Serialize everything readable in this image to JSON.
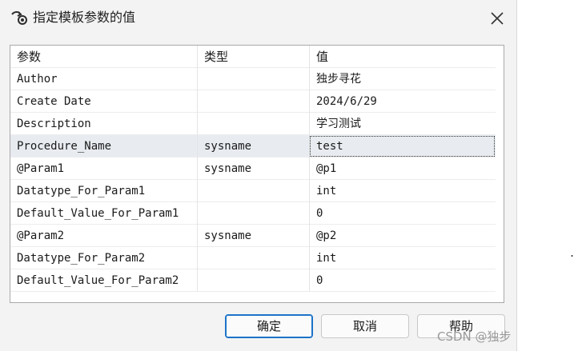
{
  "window": {
    "title": "指定模板参数的值"
  },
  "table": {
    "headers": [
      "参数",
      "类型",
      "值"
    ],
    "rows": [
      {
        "name": "Author",
        "type": "",
        "value": "独步寻花"
      },
      {
        "name": "Create Date",
        "type": "",
        "value": "2024/6/29"
      },
      {
        "name": "Description",
        "type": "",
        "value": "学习测试"
      },
      {
        "name": "Procedure_Name",
        "type": "sysname",
        "value": "test"
      },
      {
        "name": "@Param1",
        "type": "sysname",
        "value": "@p1"
      },
      {
        "name": "Datatype_For_Param1",
        "type": "",
        "value": "int"
      },
      {
        "name": "Default_Value_For_Param1",
        "type": "",
        "value": "0"
      },
      {
        "name": "@Param2",
        "type": "sysname",
        "value": "@p2"
      },
      {
        "name": "Datatype_For_Param2",
        "type": "",
        "value": "int"
      },
      {
        "name": "Default_Value_For_Param2",
        "type": "",
        "value": "0"
      }
    ],
    "selected_row": 3
  },
  "buttons": {
    "ok": "确定",
    "cancel": "取消",
    "help": "帮助"
  },
  "watermark": "CSDN @独步",
  "stray_mark": ".",
  "colors": {
    "accent": "#1b73c8",
    "selection": "#e8ecf1"
  },
  "icons": {
    "app": "sql-template-icon",
    "close": "close-icon"
  }
}
